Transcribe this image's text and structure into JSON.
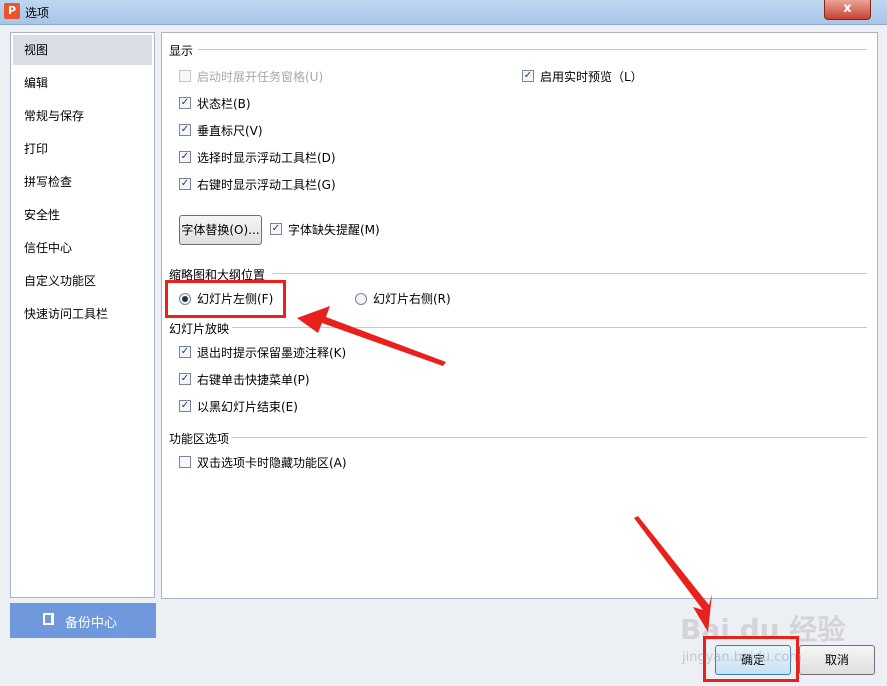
{
  "window": {
    "title": "选项",
    "app_icon_letter": "P",
    "close_label": "x"
  },
  "sidebar": {
    "items": [
      {
        "label": "视图",
        "selected": true
      },
      {
        "label": "编辑",
        "selected": false
      },
      {
        "label": "常规与保存",
        "selected": false
      },
      {
        "label": "打印",
        "selected": false
      },
      {
        "label": "拼写检查",
        "selected": false
      },
      {
        "label": "安全性",
        "selected": false
      },
      {
        "label": "信任中心",
        "selected": false
      },
      {
        "label": "自定义功能区",
        "selected": false
      },
      {
        "label": "快速访问工具栏",
        "selected": false
      }
    ],
    "backup_label": "备份中心"
  },
  "display": {
    "title": "显示",
    "startup_task_pane": {
      "label": "启动时展开任务窗格(U)",
      "checked": false,
      "disabled": true
    },
    "live_preview": {
      "label": "启用实时预览（L）",
      "checked": true
    },
    "status_bar": {
      "label": "状态栏(B)",
      "checked": true
    },
    "vertical_ruler": {
      "label": "垂直标尺(V)",
      "checked": true
    },
    "float_toolbar_select": {
      "label": "选择时显示浮动工具栏(D)",
      "checked": true
    },
    "float_toolbar_rightclick": {
      "label": "右键时显示浮动工具栏(G)",
      "checked": true
    },
    "font_replace_button": "字体替换(O)...",
    "font_missing_alert": {
      "label": "字体缺失提醒(M)",
      "checked": true
    }
  },
  "outline": {
    "title": "缩略图和大纲位置",
    "left": {
      "label": "幻灯片左侧(F)",
      "selected": true
    },
    "right": {
      "label": "幻灯片右侧(R)",
      "selected": false
    }
  },
  "slideshow": {
    "title": "幻灯片放映",
    "ink_prompt": {
      "label": "退出时提示保留墨迹注释(K)",
      "checked": true
    },
    "right_click_menu": {
      "label": "右键单击快捷菜单(P)",
      "checked": true
    },
    "end_black": {
      "label": "以黑幻灯片结束(E)",
      "checked": true
    }
  },
  "ribbon": {
    "title": "功能区选项",
    "double_click_hide": {
      "label": "双击选项卡时隐藏功能区(A)",
      "checked": false
    }
  },
  "footer": {
    "ok_label": "确定",
    "cancel_label": "取消"
  },
  "watermark": {
    "text": "Bai du 经验",
    "sub": "jingyan.baidu.com"
  },
  "colors": {
    "annotation_red": "#e8211c",
    "selected_bg": "#d9dee6",
    "backup_bg": "#6f98dd"
  }
}
